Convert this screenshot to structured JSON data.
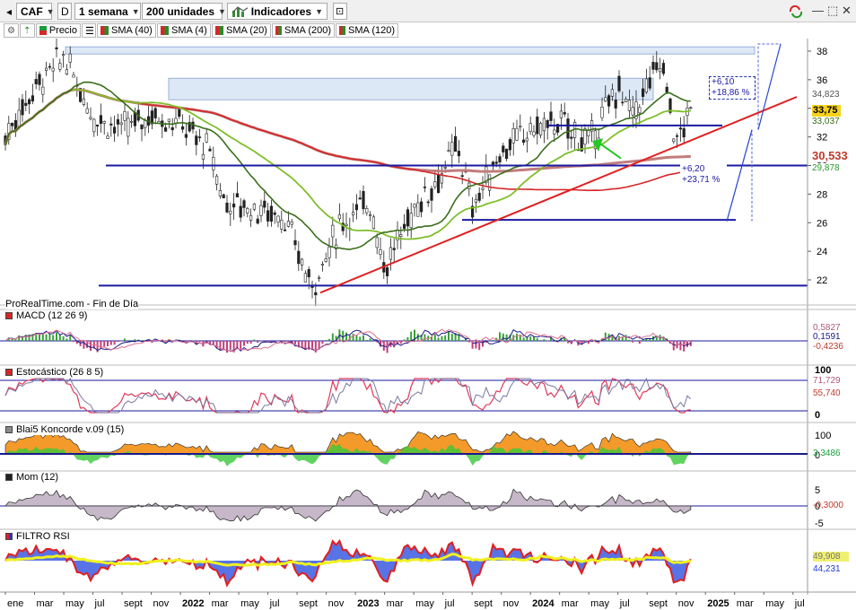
{
  "toolbar": {
    "ticker": "CAF",
    "mode": "D",
    "period": "1 semana",
    "units": "200 unidades",
    "indicators": "Indicadores"
  },
  "legend": {
    "price": "Precio",
    "sma": [
      "SMA (40)",
      "SMA (4)",
      "SMA (20)",
      "SMA (200)",
      "SMA (120)"
    ],
    "sma_colors": [
      "#d62728",
      "#7fbf2a",
      "#3a6e1a",
      "#c27c7c",
      "#1a9c3a"
    ]
  },
  "price_panel": {
    "source_label": "ProRealTime.com - Fin de Día",
    "annotation_top": [
      "+6,10",
      "+18,86 %"
    ],
    "annotation_bottom": [
      "+6,20",
      "+23,71 %"
    ],
    "badges": {
      "sma4": "34,823",
      "last": "33,75",
      "sma20": "33,037",
      "sma120": "30,533",
      "sma40": "29,878"
    }
  },
  "macd": {
    "title": "MACD (12 26 9)",
    "values": [
      "0,5827",
      "0,1591",
      "-0,4236"
    ]
  },
  "stoch": {
    "title": "Estocástico (26 8 5)",
    "values": [
      "71,729",
      "55,740"
    ]
  },
  "koncorde": {
    "title": "Blai5 Koncorde v.09 (15)",
    "values": [
      "3,3486"
    ]
  },
  "mom": {
    "title": "Mom (12)",
    "values": [
      "-0,3000"
    ]
  },
  "rsi": {
    "title": "FILTRO RSI",
    "values": [
      "49,908",
      "44,231"
    ]
  },
  "x_axis": [
    "ene",
    "mar",
    "may",
    "jul",
    "sept",
    "nov",
    "2022",
    "mar",
    "may",
    "jul",
    "sept",
    "nov",
    "2023",
    "mar",
    "may",
    "jul",
    "sept",
    "nov",
    "2024",
    "mar",
    "may",
    "jul",
    "sept",
    "nov",
    "2025",
    "mar",
    "may",
    "jul"
  ],
  "chart_data": [
    {
      "type": "candlestick",
      "title": "CAF",
      "period": "1 semana",
      "x_range": [
        "2021-01",
        "2025-07"
      ],
      "ylim": [
        21,
        39
      ],
      "y_ticks": [
        22,
        24,
        26,
        28,
        30,
        32,
        34,
        36,
        38
      ],
      "close_path": [
        [
          "2021-01",
          32.0
        ],
        [
          "2021-03",
          35.5
        ],
        [
          "2021-05",
          37.6
        ],
        [
          "2021-07",
          33.5
        ],
        [
          "2021-09",
          32.5
        ],
        [
          "2021-11",
          33.5
        ],
        [
          "2022-01",
          33.0
        ],
        [
          "2022-03",
          31.0
        ],
        [
          "2022-04",
          27.5
        ],
        [
          "2022-06",
          27.0
        ],
        [
          "2022-08",
          26.5
        ],
        [
          "2022-10",
          21.5
        ],
        [
          "2022-12",
          26.0
        ],
        [
          "2023-02",
          27.5
        ],
        [
          "2023-03",
          22.8
        ],
        [
          "2023-05",
          27.0
        ],
        [
          "2023-07",
          29.5
        ],
        [
          "2023-08",
          31.5
        ],
        [
          "2023-09",
          27.0
        ],
        [
          "2023-11",
          31.0
        ],
        [
          "2024-01",
          32.5
        ],
        [
          "2024-03",
          33.0
        ],
        [
          "2024-05",
          31.5
        ],
        [
          "2024-07",
          35.5
        ],
        [
          "2024-08",
          33.5
        ],
        [
          "2024-10",
          37.5
        ],
        [
          "2024-11",
          31.5
        ],
        [
          "2024-12",
          33.75
        ]
      ],
      "horizontal_levels": [
        21.6,
        26.2,
        30.0,
        32.8
      ],
      "sma_last": {
        "SMA (4)": 34.823,
        "SMA (20)": 33.037,
        "SMA (120)": 30.533,
        "SMA (40)": 29.878
      }
    },
    {
      "type": "bar",
      "title": "MACD (12 26 9)",
      "ylim": [
        -1,
        2
      ],
      "y_ticks": [
        2
      ],
      "last": [
        0.5827,
        0.1591,
        -0.4236
      ]
    },
    {
      "type": "line",
      "title": "Estocástico (26 8 5)",
      "ylim": [
        0,
        100
      ],
      "y_ticks": [
        0,
        100
      ],
      "last": [
        71.729,
        55.74
      ]
    },
    {
      "type": "area",
      "title": "Blai5 Koncorde v.09 (15)",
      "y_ticks": [
        100,
        0
      ],
      "last": [
        3.3486
      ]
    },
    {
      "type": "area",
      "title": "Mom (12)",
      "y_ticks": [
        5,
        0,
        -5
      ],
      "last": [
        -0.3
      ]
    },
    {
      "type": "line",
      "title": "FILTRO RSI",
      "last": [
        49.908,
        44.231
      ]
    }
  ]
}
